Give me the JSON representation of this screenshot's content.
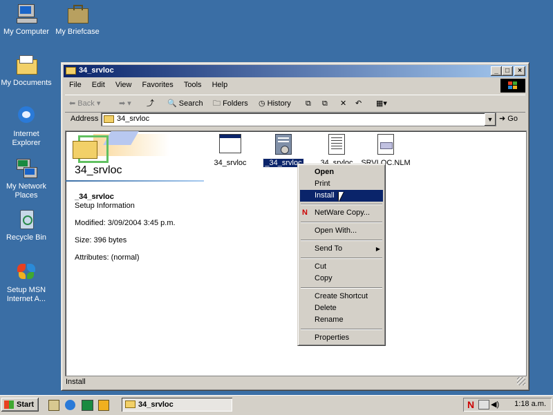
{
  "desktop": {
    "icons": [
      {
        "label": "My Computer"
      },
      {
        "label": "My Briefcase"
      },
      {
        "label": "My Documents"
      },
      {
        "label": "Internet Explorer"
      },
      {
        "label": "My Network Places"
      },
      {
        "label": "Recycle Bin"
      },
      {
        "label": "Setup MSN Internet A..."
      }
    ]
  },
  "window": {
    "title": "34_srvloc",
    "menu": [
      "File",
      "Edit",
      "View",
      "Favorites",
      "Tools",
      "Help"
    ],
    "toolbar": {
      "back": "Back",
      "search": "Search",
      "folders": "Folders",
      "history": "History"
    },
    "address": {
      "label": "Address",
      "value": "34_srvloc",
      "go": "Go"
    },
    "status": "Install"
  },
  "info_panel": {
    "folder_title": "34_srvloc",
    "file_name": "_34_srvloc",
    "file_type": "Setup Information",
    "modified": "Modified: 3/09/2004 3:45 p.m.",
    "size": "Size: 396 bytes",
    "attributes": "Attributes: (normal)"
  },
  "files": [
    {
      "name": "34_srvloc",
      "icon": "window-file-icon"
    },
    {
      "name": "_34_srvloc",
      "icon": "setup-information-icon",
      "selected": true
    },
    {
      "name": "34_srvloc",
      "icon": "text-document-icon"
    },
    {
      "name": "SRVLOC.NLM",
      "icon": "nlm-file-icon"
    }
  ],
  "context_menu": {
    "items": [
      "Open",
      "Print",
      "Install",
      "NetWare Copy...",
      "Open With...",
      "Send To",
      "Cut",
      "Copy",
      "Create Shortcut",
      "Delete",
      "Rename",
      "Properties"
    ],
    "highlighted": "Install"
  },
  "taskbar": {
    "start": "Start",
    "task": "34_srvloc",
    "clock": "1:18 a.m."
  },
  "colors": {
    "desktop": "#3a6ea5",
    "titlebar_start": "#0a246a",
    "titlebar_end": "#a6caf0",
    "selection": "#0a246a"
  }
}
